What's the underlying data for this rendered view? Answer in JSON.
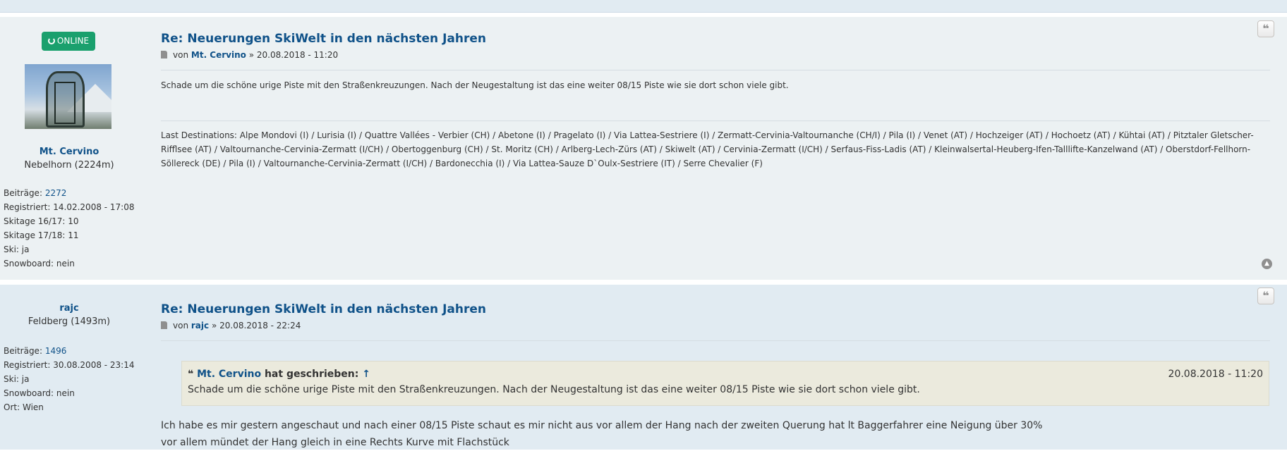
{
  "post1": {
    "online_label": "ONLINE",
    "username": "Mt. Cervino",
    "rank": "Nebelhorn (2224m)",
    "details": [
      {
        "label": "Beiträge:",
        "value": "2272",
        "link": true
      },
      {
        "label": "Registriert:",
        "value": "14.02.2008 - 17:08",
        "link": false
      },
      {
        "label": "Skitage 16/17:",
        "value": "10",
        "link": false
      },
      {
        "label": "Skitage 17/18:",
        "value": "11",
        "link": false
      },
      {
        "label": "Ski:",
        "value": "ja",
        "link": false
      },
      {
        "label": "Snowboard:",
        "value": "nein",
        "link": false
      }
    ],
    "title": "Re: Neuerungen SkiWelt in den nächsten Jahren",
    "meta_prefix": "von",
    "meta_author": "Mt. Cervino",
    "meta_date": "» 20.08.2018 - 11:20",
    "text": "Schade um die schöne urige Piste mit den Straßenkreuzungen. Nach der Neugestaltung ist das eine weiter 08/15 Piste wie sie dort schon viele gibt.",
    "signature_lines": [
      "Last Destinations: Alpe Mondovi (I) / Lurisia (I) / Quattre Vallées - Verbier (CH) / Abetone (I) / Pragelato (I) / Via Lattea-Sestriere (I) / Zermatt-Cervinia-Valtournanche (CH/I) / Pila (I) / Venet (AT) / Hochzeiger (AT) / Hochoetz (AT) / Kühtai (AT) / Pitztaler Gletscher-",
      "Rifflsee (AT) / Valtournanche-Cervinia-Zermatt (I/CH) / Obertoggenburg (CH) / St. Moritz (CH) / Arlberg-Lech-Zürs (AT) / Skiwelt (AT) / Cervinia-Zermatt (I/CH) / Serfaus-Fiss-Ladis (AT) / Kleinwalsertal-Heuberg-Ifen-Talllifte-Kanzelwand (AT) / Oberstdorf-Fellhorn-",
      "Söllereck (DE) / Pila (I) / Valtournanche-Cervinia-Zermatt (I/CH) / Bardonecchia (I) / Via Lattea-Sauze D`Oulx-Sestriere (IT) / Serre Chevalier (F)"
    ]
  },
  "post2": {
    "username": "rajc",
    "rank": "Feldberg (1493m)",
    "details": [
      {
        "label": "Beiträge:",
        "value": "1496",
        "link": true
      },
      {
        "label": "Registriert:",
        "value": "30.08.2008 - 23:14",
        "link": false
      },
      {
        "label": "Ski:",
        "value": "ja",
        "link": false
      },
      {
        "label": "Snowboard:",
        "value": "nein",
        "link": false
      },
      {
        "label": "Ort:",
        "value": "Wien",
        "link": false
      }
    ],
    "title": "Re: Neuerungen SkiWelt in den nächsten Jahren",
    "meta_prefix": "von",
    "meta_author": "rajc",
    "meta_date": "» 20.08.2018 - 22:24",
    "quote_author": "Mt. Cervino",
    "quote_suffix": "hat geschrieben:",
    "quote_arrow": "↑",
    "quote_date": "20.08.2018 - 11:20",
    "quote_text": "Schade um die schöne urige Piste mit den Straßenkreuzungen. Nach der Neugestaltung ist das eine weiter 08/15 Piste wie sie dort schon viele gibt.",
    "reply_lines": [
      "Ich habe es mir gestern angeschaut und nach einer 08/15 Piste schaut es mir nicht aus vor allem der Hang nach der zweiten Querung hat lt Baggerfahrer eine Neigung über 30%",
      "vor allem mündet der Hang gleich in eine Rechts Kurve mit Flachstück"
    ]
  },
  "icons": {
    "quote": "quote-icon",
    "top": "back-to-top-icon",
    "post": "post-icon",
    "power": "power-icon"
  }
}
